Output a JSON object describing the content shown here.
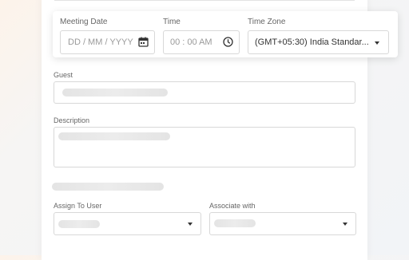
{
  "meeting": {
    "date_label": "Meeting Date",
    "date_placeholder": "DD / MM / YYYY",
    "time_label": "Time",
    "time_placeholder": "00 : 00 AM",
    "timezone_label": "Time Zone",
    "timezone_value": "(GMT+05:30) India Standar..."
  },
  "form": {
    "guest_label": "Guest",
    "description_label": "Description",
    "assign_label": "Assign To User",
    "associate_label": "Associate with"
  },
  "icons": {
    "calendar": "calendar-icon",
    "clock": "clock-icon",
    "dropdown": "caret-down-icon"
  }
}
